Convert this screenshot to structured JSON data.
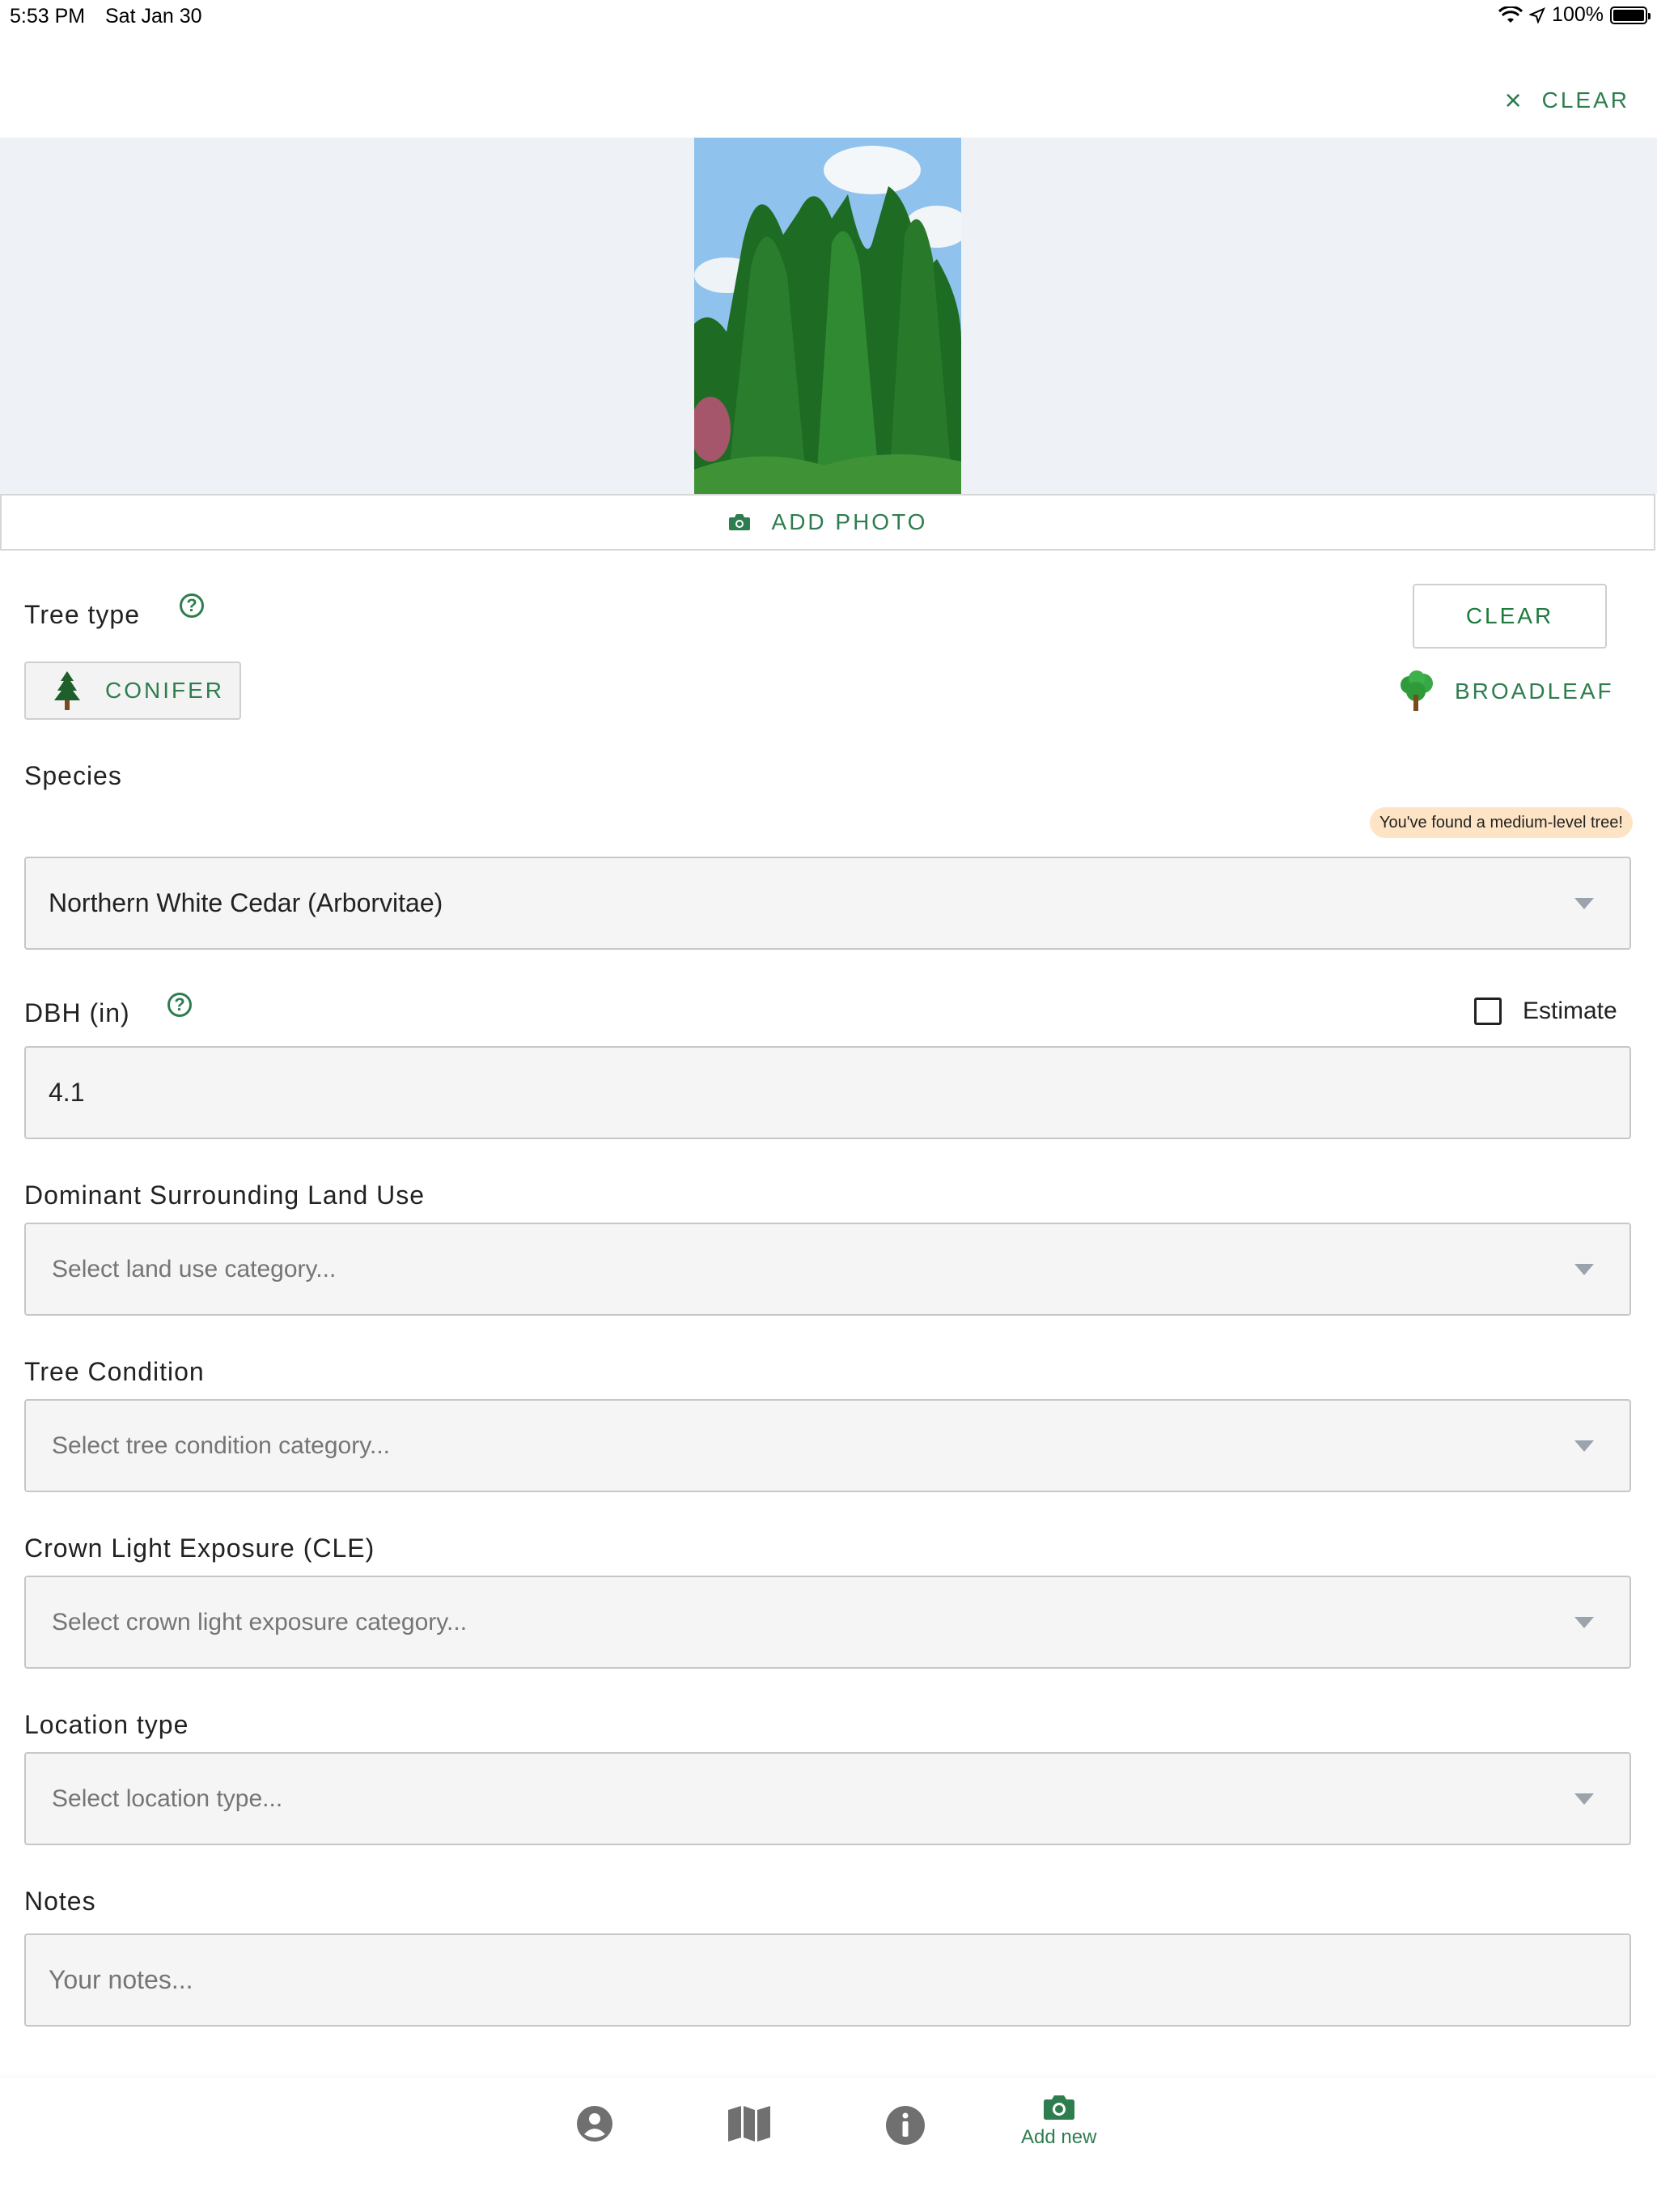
{
  "status_bar": {
    "time": "5:53 PM",
    "date": "Sat Jan 30",
    "battery": "100%"
  },
  "header": {
    "clear_label": "CLEAR"
  },
  "photo": {
    "add_photo_label": "ADD PHOTO"
  },
  "tree_type": {
    "label": "Tree type",
    "clear_label": "CLEAR",
    "conifer_label": "CONIFER",
    "broadleaf_label": "BROADLEAF"
  },
  "species": {
    "label": "Species",
    "badge": "You've found a medium-level tree!",
    "value": "Northern White Cedar (Arborvitae)"
  },
  "dbh": {
    "label": "DBH (in)",
    "value": "4.1",
    "estimate_label": "Estimate",
    "estimate_checked": false
  },
  "land_use": {
    "label": "Dominant Surrounding Land Use",
    "placeholder": "Select land use category..."
  },
  "condition": {
    "label": "Tree Condition",
    "placeholder": "Select tree condition category..."
  },
  "cle": {
    "label": "Crown Light Exposure (CLE)",
    "placeholder": "Select crown light exposure category..."
  },
  "location": {
    "label": "Location type",
    "placeholder": "Select location type..."
  },
  "notes": {
    "label": "Notes",
    "placeholder": "Your notes..."
  },
  "tabbar": {
    "add_new_label": "Add new"
  },
  "icons": [
    "wifi-icon",
    "location-arrow-icon",
    "battery-icon",
    "close-icon",
    "camera-icon",
    "help-icon",
    "conifer-tree-icon",
    "broadleaf-tree-icon",
    "chevron-down-icon",
    "profile-icon",
    "map-icon",
    "info-icon"
  ],
  "colors": {
    "accent": "#2e7d4f",
    "photo_bg": "#eef1f5",
    "field_bg": "#f5f5f5",
    "badge_bg": "#fde4c4"
  }
}
